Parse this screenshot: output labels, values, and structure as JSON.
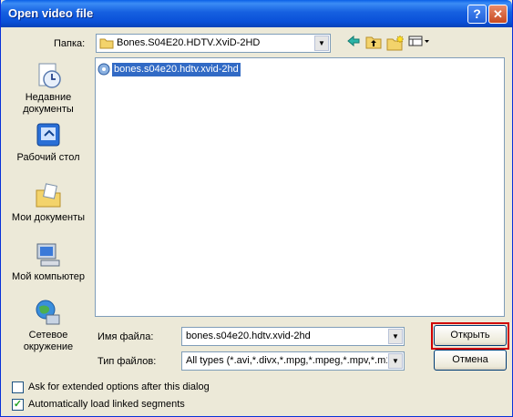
{
  "title": "Open video file",
  "title_buttons": {
    "help": "?",
    "close": "✕"
  },
  "lookin": {
    "label": "Папка:",
    "value": "Bones.S04E20.HDTV.XviD-2HD"
  },
  "toolbar": [
    "back-icon",
    "up-folder-icon",
    "new-folder-icon",
    "view-menu-icon"
  ],
  "places": [
    {
      "label": "Недавние документы",
      "icon": "recent-documents-icon"
    },
    {
      "label": "Рабочий стол",
      "icon": "desktop-icon"
    },
    {
      "label": "Мои документы",
      "icon": "my-documents-icon"
    },
    {
      "label": "Мой компьютер",
      "icon": "my-computer-icon"
    },
    {
      "label": "Сетевое окружение",
      "icon": "network-icon"
    }
  ],
  "files": [
    {
      "name": "bones.s04e20.hdtv.xvid-2hd",
      "selected": true
    }
  ],
  "filename": {
    "label": "Имя файла:",
    "value": "bones.s04e20.hdtv.xvid-2hd"
  },
  "filetype": {
    "label": "Тип файлов:",
    "value": "All types (*.avi,*.divx,*.mpg,*.mpeg,*.mpv,*.m1v"
  },
  "buttons": {
    "open": "Открыть",
    "cancel": "Отмена"
  },
  "options": [
    {
      "label": "Ask for extended options after this dialog",
      "checked": false
    },
    {
      "label": "Automatically load linked segments",
      "checked": true
    }
  ]
}
